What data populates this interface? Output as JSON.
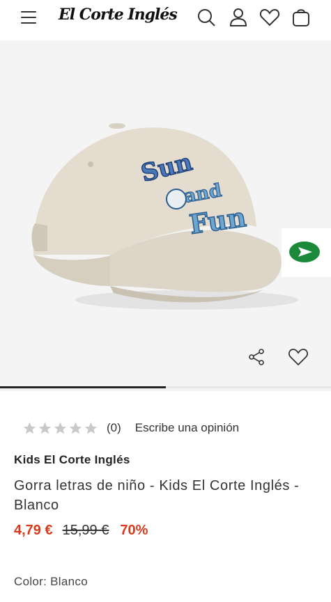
{
  "header": {
    "logo_text": "El Corte Inglés",
    "icons": [
      "menu-icon",
      "search-icon",
      "user-icon",
      "heart-icon",
      "bag-icon"
    ]
  },
  "gallery": {
    "image_alt": "Gorra beige con letras Sun and Fun",
    "print_text": [
      "Sun",
      "and",
      "Fun"
    ],
    "progress": 0.5
  },
  "rating": {
    "stars": 0,
    "count": "(0)",
    "write_review": "Escribe una opinión"
  },
  "product": {
    "brand": "Kids El Corte Inglés",
    "title": "Gorra letras de niño - Kids El Corte Inglés - Blanco",
    "price_now": "4,79 €",
    "price_old": "15,99 €",
    "discount": "70%",
    "color_label": "Color: Blanco"
  },
  "colors": {
    "price_accent": "#d83a1c",
    "float_button": "#1a8a3a",
    "cap": "#e2dccf"
  }
}
